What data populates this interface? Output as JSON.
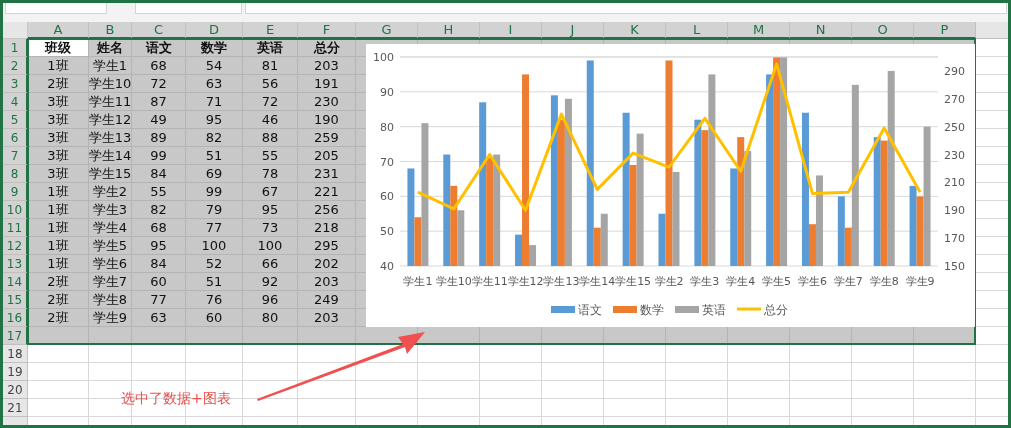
{
  "sheet": {
    "columns": [
      {
        "label": "A",
        "selected": true
      },
      {
        "label": "B",
        "selected": true
      },
      {
        "label": "C",
        "selected": true
      },
      {
        "label": "D",
        "selected": true
      },
      {
        "label": "E",
        "selected": true
      },
      {
        "label": "F",
        "selected": true
      },
      {
        "label": "G",
        "selected": true
      },
      {
        "label": "H",
        "selected": true
      },
      {
        "label": "I",
        "selected": true
      },
      {
        "label": "J",
        "selected": true
      },
      {
        "label": "K",
        "selected": true
      },
      {
        "label": "L",
        "selected": true
      },
      {
        "label": "M",
        "selected": true
      },
      {
        "label": "N",
        "selected": true
      },
      {
        "label": "O",
        "selected": true
      },
      {
        "label": "P",
        "selected": true
      }
    ],
    "rows": [
      {
        "number": "1",
        "kind": "header",
        "selected": true,
        "cells": [
          {
            "text": "班级",
            "active": true
          },
          {
            "text": "姓名",
            "active": false
          },
          {
            "text": "语文",
            "active": false
          },
          {
            "text": "数学",
            "active": false
          },
          {
            "text": "英语",
            "active": false
          },
          {
            "text": "总分",
            "active": false
          }
        ]
      },
      {
        "number": "2",
        "kind": "data",
        "selected": true,
        "cells": [
          {
            "text": "1班",
            "active": false
          },
          {
            "text": "学生1",
            "active": false
          },
          {
            "text": "68",
            "active": false
          },
          {
            "text": "54",
            "active": false
          },
          {
            "text": "81",
            "active": false
          },
          {
            "text": "203",
            "active": false
          }
        ]
      },
      {
        "number": "3",
        "kind": "data",
        "selected": true,
        "cells": [
          {
            "text": "2班",
            "active": false
          },
          {
            "text": "学生10",
            "active": false
          },
          {
            "text": "72",
            "active": false
          },
          {
            "text": "63",
            "active": false
          },
          {
            "text": "56",
            "active": false
          },
          {
            "text": "191",
            "active": false
          }
        ]
      },
      {
        "number": "4",
        "kind": "data",
        "selected": true,
        "cells": [
          {
            "text": "3班",
            "active": false
          },
          {
            "text": "学生11",
            "active": false
          },
          {
            "text": "87",
            "active": false
          },
          {
            "text": "71",
            "active": false
          },
          {
            "text": "72",
            "active": false
          },
          {
            "text": "230",
            "active": false
          }
        ]
      },
      {
        "number": "5",
        "kind": "data",
        "selected": true,
        "cells": [
          {
            "text": "3班",
            "active": false
          },
          {
            "text": "学生12",
            "active": false
          },
          {
            "text": "49",
            "active": false
          },
          {
            "text": "95",
            "active": false
          },
          {
            "text": "46",
            "active": false
          },
          {
            "text": "190",
            "active": false
          }
        ]
      },
      {
        "number": "6",
        "kind": "data",
        "selected": true,
        "cells": [
          {
            "text": "3班",
            "active": false
          },
          {
            "text": "学生13",
            "active": false
          },
          {
            "text": "89",
            "active": false
          },
          {
            "text": "82",
            "active": false
          },
          {
            "text": "88",
            "active": false
          },
          {
            "text": "259",
            "active": false
          }
        ]
      },
      {
        "number": "7",
        "kind": "data",
        "selected": true,
        "cells": [
          {
            "text": "3班",
            "active": false
          },
          {
            "text": "学生14",
            "active": false
          },
          {
            "text": "99",
            "active": false
          },
          {
            "text": "51",
            "active": false
          },
          {
            "text": "55",
            "active": false
          },
          {
            "text": "205",
            "active": false
          }
        ]
      },
      {
        "number": "8",
        "kind": "data",
        "selected": true,
        "cells": [
          {
            "text": "3班",
            "active": false
          },
          {
            "text": "学生15",
            "active": false
          },
          {
            "text": "84",
            "active": false
          },
          {
            "text": "69",
            "active": false
          },
          {
            "text": "78",
            "active": false
          },
          {
            "text": "231",
            "active": false
          }
        ]
      },
      {
        "number": "9",
        "kind": "data",
        "selected": true,
        "cells": [
          {
            "text": "1班",
            "active": false
          },
          {
            "text": "学生2",
            "active": false
          },
          {
            "text": "55",
            "active": false
          },
          {
            "text": "99",
            "active": false
          },
          {
            "text": "67",
            "active": false
          },
          {
            "text": "221",
            "active": false
          }
        ]
      },
      {
        "number": "10",
        "kind": "data",
        "selected": true,
        "cells": [
          {
            "text": "1班",
            "active": false
          },
          {
            "text": "学生3",
            "active": false
          },
          {
            "text": "82",
            "active": false
          },
          {
            "text": "79",
            "active": false
          },
          {
            "text": "95",
            "active": false
          },
          {
            "text": "256",
            "active": false
          }
        ]
      },
      {
        "number": "11",
        "kind": "data",
        "selected": true,
        "cells": [
          {
            "text": "1班",
            "active": false
          },
          {
            "text": "学生4",
            "active": false
          },
          {
            "text": "68",
            "active": false
          },
          {
            "text": "77",
            "active": false
          },
          {
            "text": "73",
            "active": false
          },
          {
            "text": "218",
            "active": false
          }
        ]
      },
      {
        "number": "12",
        "kind": "data",
        "selected": true,
        "cells": [
          {
            "text": "1班",
            "active": false
          },
          {
            "text": "学生5",
            "active": false
          },
          {
            "text": "95",
            "active": false
          },
          {
            "text": "100",
            "active": false
          },
          {
            "text": "100",
            "active": false
          },
          {
            "text": "295",
            "active": false
          }
        ]
      },
      {
        "number": "13",
        "kind": "data",
        "selected": true,
        "cells": [
          {
            "text": "1班",
            "active": false
          },
          {
            "text": "学生6",
            "active": false
          },
          {
            "text": "84",
            "active": false
          },
          {
            "text": "52",
            "active": false
          },
          {
            "text": "66",
            "active": false
          },
          {
            "text": "202",
            "active": false
          }
        ]
      },
      {
        "number": "14",
        "kind": "data",
        "selected": true,
        "cells": [
          {
            "text": "2班",
            "active": false
          },
          {
            "text": "学生7",
            "active": false
          },
          {
            "text": "60",
            "active": false
          },
          {
            "text": "51",
            "active": false
          },
          {
            "text": "92",
            "active": false
          },
          {
            "text": "203",
            "active": false
          }
        ]
      },
      {
        "number": "15",
        "kind": "data",
        "selected": true,
        "cells": [
          {
            "text": "2班",
            "active": false
          },
          {
            "text": "学生8",
            "active": false
          },
          {
            "text": "77",
            "active": false
          },
          {
            "text": "76",
            "active": false
          },
          {
            "text": "96",
            "active": false
          },
          {
            "text": "249",
            "active": false
          }
        ]
      },
      {
        "number": "16",
        "kind": "data",
        "selected": true,
        "cells": [
          {
            "text": "2班",
            "active": false
          },
          {
            "text": "学生9",
            "active": false
          },
          {
            "text": "63",
            "active": false
          },
          {
            "text": "60",
            "active": false
          },
          {
            "text": "80",
            "active": false
          },
          {
            "text": "203",
            "active": false
          }
        ]
      },
      {
        "number": "17",
        "kind": "empty",
        "selected": true
      },
      {
        "number": "18",
        "kind": "empty",
        "selected": false
      },
      {
        "number": "19",
        "kind": "empty",
        "selected": false
      },
      {
        "number": "20",
        "kind": "empty",
        "selected": false
      },
      {
        "number": "21",
        "kind": "empty",
        "selected": false
      },
      {
        "kind": "empty",
        "selected": false
      }
    ]
  },
  "chart": {
    "bars": {
      "chart_data": {
        "type": "bar",
        "categories": [
          "学生1",
          "学生10",
          "学生11",
          "学生12",
          "学生13",
          "学生14",
          "学生15",
          "学生2",
          "学生3",
          "学生4",
          "学生5",
          "学生6",
          "学生7",
          "学生8",
          "学生9"
        ],
        "stacked": false,
        "grid": true,
        "legend": "bottom",
        "series": [
          {
            "name": "语文",
            "color": "#5b9bd5",
            "values": [
              68,
              72,
              87,
              49,
              89,
              99,
              84,
              55,
              82,
              68,
              95,
              84,
              60,
              77,
              63
            ]
          },
          {
            "name": "数学",
            "color": "#ed7d31",
            "values": [
              54,
              63,
              71,
              95,
              82,
              51,
              69,
              99,
              79,
              77,
              100,
              52,
              51,
              76,
              60
            ]
          },
          {
            "name": "英语",
            "color": "#a5a5a5",
            "values": [
              81,
              56,
              72,
              46,
              88,
              55,
              78,
              67,
              95,
              73,
              100,
              66,
              92,
              96,
              80
            ]
          }
        ],
        "ylim": [
          40,
          100
        ],
        "yticks": [
          40,
          50,
          60,
          70,
          80,
          90,
          100
        ]
      }
    },
    "total_line": {
      "chart_data": {
        "type": "line",
        "legend": "bottom",
        "series": [
          {
            "name": "总分",
            "color": "#ffc000",
            "values": [
              203,
              191,
              230,
              190,
              259,
              205,
              231,
              221,
              256,
              218,
              295,
              202,
              203,
              249,
              203
            ]
          }
        ],
        "ylim": [
          150,
          300
        ],
        "yticks": [
          150,
          170,
          190,
          210,
          230,
          250,
          270,
          290
        ]
      }
    }
  },
  "annotation": {
    "text": "选中了数据+图表"
  }
}
